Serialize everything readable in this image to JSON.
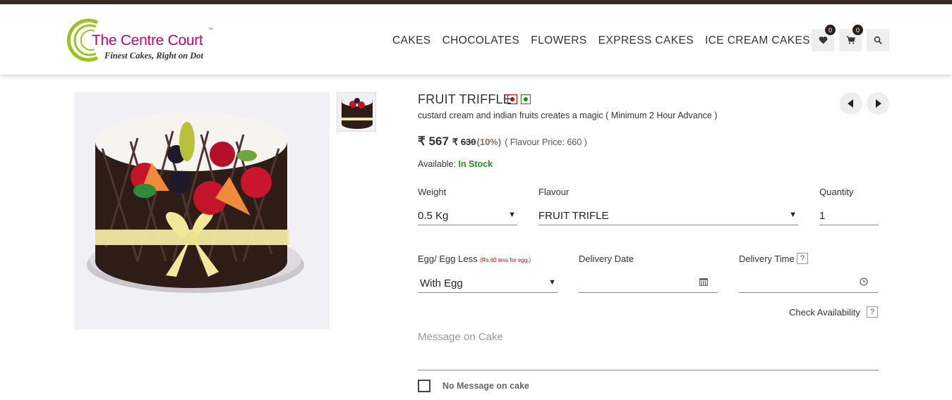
{
  "brand": {
    "name": "The Centre Court",
    "tm": "™",
    "tagline": "Finest Cakes, Right on Dot",
    "colors": {
      "primary": "#d6006b",
      "ring": "#9cc31a",
      "dark": "#3a2a26"
    }
  },
  "nav": [
    "CAKES",
    "CHOCOLATES",
    "FLOWERS",
    "EXPRESS CAKES",
    "ICE CREAM CAKES"
  ],
  "header_icons": {
    "wishlist": {
      "icon": "heart-icon",
      "count": "0"
    },
    "cart": {
      "icon": "cart-icon",
      "count": "0"
    },
    "search": {
      "icon": "search-icon"
    }
  },
  "product": {
    "title": "FRUIT TRIFFLE",
    "description": "custard cream and indian fruits creates a magic ( Minimum 2 Hour Advance )",
    "price": "₹ 567",
    "old_price_symbol": "₹",
    "old_price": "630",
    "discount": "(10%)",
    "flavour_price": "( Flavour Price: 660 )",
    "available_label": "Available:",
    "stock_status": "In Stock"
  },
  "form": {
    "weight_label": "Weight",
    "weight_value": "0.5 Kg",
    "flavour_label": "Flavour",
    "flavour_value": "FRUIT TRIFLE",
    "quantity_label": "Quantity",
    "quantity_value": "1",
    "egg_label": "Egg/ Egg Less",
    "egg_note": "(Rs.60 less for egg.)",
    "egg_value": "With Egg",
    "delivery_date_label": "Delivery Date",
    "delivery_time_label": "Delivery Time",
    "help_mark": "?",
    "check_availability": "Check Availability",
    "message_placeholder": "Message on Cake",
    "no_message_label": "No Message on cake"
  }
}
